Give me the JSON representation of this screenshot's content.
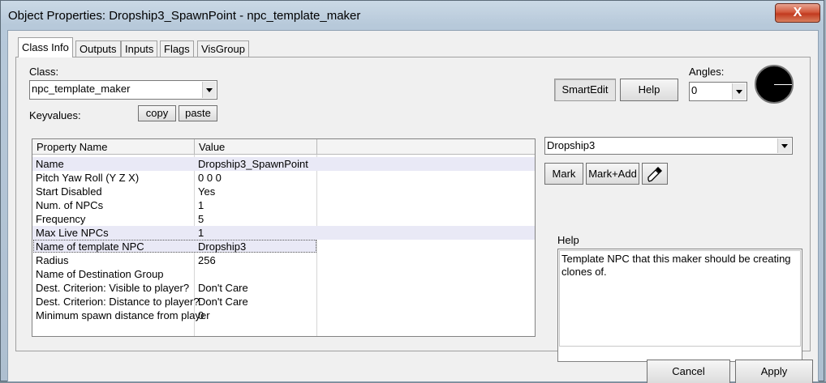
{
  "window": {
    "title": "Object Properties: Dropship3_SpawnPoint - npc_template_maker",
    "close_glyph": "X"
  },
  "tabs": [
    "Class Info",
    "Outputs",
    "Inputs",
    "Flags",
    "VisGroup"
  ],
  "class_info": {
    "class_label": "Class:",
    "class_value": "npc_template_maker",
    "keyvalues_label": "Keyvalues:",
    "copy_label": "copy",
    "paste_label": "paste",
    "smartedit_label": "SmartEdit",
    "help_label": "Help",
    "angles_label": "Angles:",
    "angles_value": "0"
  },
  "grid": {
    "columns": [
      "Property Name",
      "Value"
    ],
    "rows": [
      {
        "name": "Name",
        "value": "Dropship3_SpawnPoint"
      },
      {
        "name": "Pitch Yaw Roll (Y Z X)",
        "value": "0 0 0"
      },
      {
        "name": "Start Disabled",
        "value": "Yes"
      },
      {
        "name": "Num. of NPCs",
        "value": "1"
      },
      {
        "name": "Frequency",
        "value": "5"
      },
      {
        "name": "Max Live NPCs",
        "value": "1"
      },
      {
        "name": "Name of template NPC",
        "value": "Dropship3"
      },
      {
        "name": "Radius",
        "value": "256"
      },
      {
        "name": "Name of Destination Group",
        "value": ""
      },
      {
        "name": "Dest. Criterion: Visible to player?",
        "value": "Don't Care"
      },
      {
        "name": "Dest. Criterion: Distance to player?",
        "value": "Don't Care"
      },
      {
        "name": "Minimum spawn distance from player",
        "value": "0"
      }
    ]
  },
  "value_editor": {
    "value": "Dropship3",
    "mark_label": "Mark",
    "mark_add_label": "Mark+Add",
    "eyedropper_icon": "eyedropper-icon"
  },
  "help_panel": {
    "label": "Help",
    "text": "Template NPC that this maker should be creating clones of."
  },
  "footer": {
    "cancel_label": "Cancel",
    "apply_label": "Apply"
  }
}
